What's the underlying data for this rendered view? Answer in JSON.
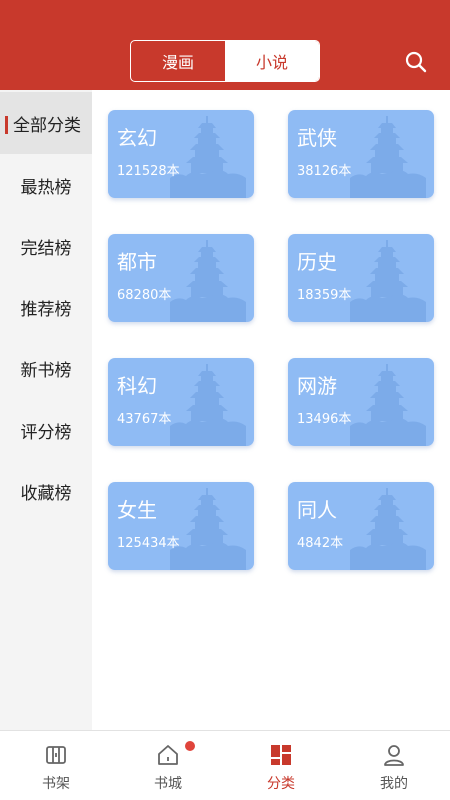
{
  "header": {
    "tabs": [
      {
        "label": "漫画"
      },
      {
        "label": "小说"
      }
    ],
    "search_icon": "search-icon"
  },
  "sidebar": {
    "items": [
      {
        "label": "全部分类"
      },
      {
        "label": "最热榜"
      },
      {
        "label": "完结榜"
      },
      {
        "label": "推荐榜"
      },
      {
        "label": "新书榜"
      },
      {
        "label": "评分榜"
      },
      {
        "label": "收藏榜"
      }
    ]
  },
  "categories": [
    {
      "name": "玄幻",
      "count": "121528本"
    },
    {
      "name": "武侠",
      "count": "38126本"
    },
    {
      "name": "都市",
      "count": "68280本"
    },
    {
      "name": "历史",
      "count": "18359本"
    },
    {
      "name": "科幻",
      "count": "43767本"
    },
    {
      "name": "网游",
      "count": "13496本"
    },
    {
      "name": "女生",
      "count": "125434本"
    },
    {
      "name": "同人",
      "count": "4842本"
    }
  ],
  "tabbar": {
    "items": [
      {
        "label": "书架",
        "icon": "bookshelf-icon"
      },
      {
        "label": "书城",
        "icon": "home-icon"
      },
      {
        "label": "分类",
        "icon": "category-icon"
      },
      {
        "label": "我的",
        "icon": "profile-icon"
      }
    ]
  },
  "colors": {
    "brand": "#c8392c",
    "card": "#8fbbf4"
  }
}
